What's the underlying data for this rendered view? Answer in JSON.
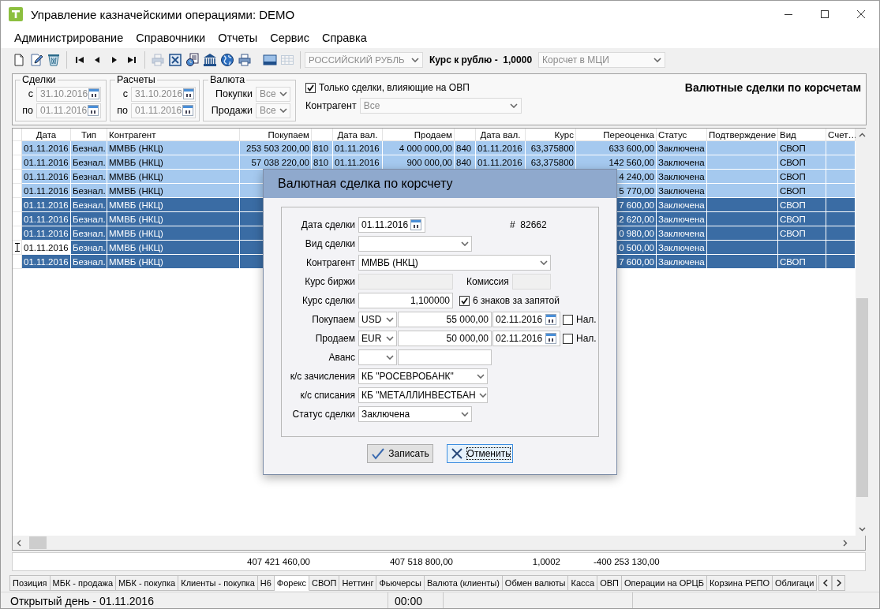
{
  "window": {
    "title": "Управление казначейскими операциями: DEMO"
  },
  "menu": [
    "Администрирование",
    "Справочники",
    "Отчеты",
    "Сервис",
    "Справка"
  ],
  "toolbar": {
    "buttons": [
      {
        "kind": "new",
        "disabled": false
      },
      {
        "kind": "edit",
        "disabled": false
      },
      {
        "kind": "delete",
        "disabled": false
      },
      {
        "kind": "first",
        "disabled": false
      },
      {
        "kind": "prev",
        "disabled": false
      },
      {
        "kind": "next",
        "disabled": false
      },
      {
        "kind": "last",
        "disabled": false
      },
      {
        "kind": "print",
        "disabled": true
      },
      {
        "kind": "excel",
        "disabled": false
      },
      {
        "kind": "report",
        "disabled": false
      },
      {
        "kind": "bank",
        "disabled": false
      },
      {
        "kind": "globe",
        "disabled": false
      },
      {
        "kind": "printer",
        "disabled": false
      },
      {
        "kind": "window",
        "disabled": false
      },
      {
        "kind": "table",
        "disabled": true
      }
    ],
    "currency": {
      "value": "РОССИЙСКИЙ РУБЛЬ",
      "disabled": true
    },
    "rate_label": "Курс к рублю -  1,0000",
    "account": {
      "value": "Корсчет в МЦИ",
      "disabled": true
    }
  },
  "filters": {
    "groups": [
      {
        "title": "Сделки",
        "from_label": "с",
        "from": "31.10.2016",
        "to_label": "по",
        "to": "01.11.2016",
        "disabled": true
      },
      {
        "title": "Расчеты",
        "from_label": "с",
        "from": "31.10.2016",
        "to_label": "по",
        "to": "01.11.2016",
        "disabled": true
      }
    ],
    "currency": {
      "title": "Валюта",
      "buy_label": "Покупки",
      "buy": "Все",
      "sell_label": "Продажи",
      "sell": "Все",
      "disabled": true
    },
    "ovp_only": {
      "label": "Только сделки, влияющие на ОВП",
      "checked": true
    },
    "counterparty": {
      "label": "Контрагент",
      "value": "Все",
      "disabled": true
    },
    "heading": "Валютные сделки по корсчетам"
  },
  "grid": {
    "columns": [
      {
        "label": "Дата"
      },
      {
        "label": "Тип"
      },
      {
        "label": "Контрагент"
      },
      {
        "label": "Покупаем"
      },
      {},
      {
        "label": "Дата вал."
      },
      {
        "label": "Продаем"
      },
      {},
      {
        "label": "Дата вал."
      },
      {
        "label": "Курс"
      },
      {
        "label": "Переоценка"
      },
      {
        "label": "Статус"
      },
      {
        "label": "Подтверждение"
      },
      {
        "label": "Вид"
      },
      {
        "label": "Счет…"
      }
    ],
    "rows": [
      {
        "selected": false,
        "current": false,
        "date": "01.11.2016",
        "type": "Безнал.",
        "counterparty": "ММВБ (НКЦ)",
        "buy": "253 503 200,00",
        "buy_cur": "810",
        "buy_date": "01.11.2016",
        "sell": "4 000 000,00",
        "sell_cur": "840",
        "sell_date": "01.11.2016",
        "rate": "63,375800",
        "reval": "633 600,00",
        "status": "Заключена",
        "kind": "СВОП"
      },
      {
        "selected": false,
        "current": false,
        "date": "01.11.2016",
        "type": "Безнал.",
        "counterparty": "ММВБ (НКЦ)",
        "buy": "57 038 220,00",
        "buy_cur": "810",
        "buy_date": "01.11.2016",
        "sell": "900 000,00",
        "sell_cur": "840",
        "sell_date": "01.11.2016",
        "rate": "63,375800",
        "reval": "142 560,00",
        "status": "Заключена",
        "kind": "СВОП"
      },
      {
        "selected": false,
        "current": false,
        "date": "01.11.2016",
        "type": "Безнал.",
        "counterparty": "ММВБ (НКЦ)",
        "reval": "4 240,00",
        "status": "Заключена",
        "kind": "СВОП"
      },
      {
        "selected": false,
        "current": false,
        "date": "01.11.2016",
        "type": "Безнал.",
        "counterparty": "ММВБ (НКЦ)",
        "reval": "5 770,00",
        "status": "Заключена",
        "kind": "СВОП"
      },
      {
        "selected": true,
        "current": false,
        "date": "01.11.2016",
        "type": "Безнал.",
        "counterparty": "ММВБ (НКЦ)",
        "reval": "7 600,00",
        "status": "Заключена",
        "kind": "СВОП"
      },
      {
        "selected": true,
        "current": false,
        "date": "01.11.2016",
        "type": "Безнал.",
        "counterparty": "ММВБ (НКЦ)",
        "reval": "2 620,00",
        "status": "Заключена",
        "kind": "СВОП"
      },
      {
        "selected": true,
        "current": false,
        "date": "01.11.2016",
        "type": "Безнал.",
        "counterparty": "ММВБ (НКЦ)",
        "reval": "0 980,00",
        "status": "Заключена",
        "kind": "СВОП"
      },
      {
        "selected": true,
        "current": true,
        "date": "01.11.2016",
        "type": "Безнал.",
        "counterparty": "ММВБ (НКЦ)",
        "reval": "0 500,00",
        "status": "Заключена"
      },
      {
        "selected": true,
        "current": false,
        "date": "01.11.2016",
        "type": "Безнал.",
        "counterparty": "ММВБ (НКЦ)",
        "reval": "7 600,00",
        "status": "Заключена",
        "kind": "СВОП"
      }
    ],
    "totals": {
      "buy": "407 421 460,00",
      "sell": "407 518 800,00",
      "rate": "1,0002",
      "reval": "-400 253 130,00"
    }
  },
  "dialog": {
    "title": "Валютная сделка по корсчету",
    "rows": [
      {
        "label": "Дата сделки",
        "controls": [
          {
            "kind": "date",
            "value": "01.11.2016"
          },
          {
            "kind": "note",
            "text": "#  82662"
          }
        ]
      },
      {
        "label": "Вид сделки",
        "controls": [
          {
            "kind": "combo"
          }
        ]
      },
      {
        "label": "Контрагент",
        "controls": [
          {
            "kind": "combo",
            "value": "ММВБ (НКЦ)"
          }
        ]
      },
      {
        "label": "Курс биржи",
        "controls": [
          {
            "kind": "readonly"
          },
          {
            "kind": "note",
            "text": "Комиссия"
          },
          {
            "kind": "readonly"
          }
        ]
      },
      {
        "label": "Курс сделки",
        "controls": [
          {
            "kind": "number",
            "value": "1,100000"
          },
          {
            "kind": "checkbox",
            "label": "6 знаков за запятой",
            "checked": true
          }
        ]
      },
      {
        "label": "Покупаем",
        "controls": [
          {
            "kind": "combo",
            "value": "USD"
          },
          {
            "kind": "number",
            "value": "55 000,00"
          },
          {
            "kind": "date",
            "value": "02.11.2016"
          },
          {
            "kind": "checkbox",
            "label": "Нал.",
            "checked": false
          }
        ]
      },
      {
        "label": "Продаем",
        "controls": [
          {
            "kind": "combo",
            "value": "EUR"
          },
          {
            "kind": "number",
            "value": "50 000,00"
          },
          {
            "kind": "date",
            "value": "02.11.2016"
          },
          {
            "kind": "checkbox",
            "label": "Нал.",
            "checked": false
          }
        ]
      },
      {
        "label": "Аванс",
        "controls": [
          {
            "kind": "combo"
          },
          {
            "kind": "number"
          }
        ]
      },
      {
        "label": "к/с зачисления",
        "controls": [
          {
            "kind": "combo",
            "value": "КБ \"РОСЕВРОБАНК\""
          }
        ]
      },
      {
        "label": "к/с списания",
        "controls": [
          {
            "kind": "combo",
            "value": "КБ \"МЕТАЛЛИНВЕСТБАН"
          }
        ]
      },
      {
        "label": "Статус сделки",
        "controls": [
          {
            "kind": "combo",
            "value": "Заключена"
          }
        ]
      }
    ],
    "buttons": [
      {
        "kind": "save",
        "label": "Записать",
        "focused": false
      },
      {
        "kind": "cancel",
        "label": "Отменить",
        "focused": true
      }
    ]
  },
  "tabs": [
    {
      "label": "Позиция",
      "selected": false
    },
    {
      "label": "МБК - продажа",
      "selected": false
    },
    {
      "label": "МБК - покупка",
      "selected": false
    },
    {
      "label": "Клиенты - покупка",
      "selected": false
    },
    {
      "label": "Н6",
      "selected": false
    },
    {
      "label": "Форекс",
      "selected": true
    },
    {
      "label": "СВОП",
      "selected": false
    },
    {
      "label": "Неттинг",
      "selected": false
    },
    {
      "label": "Фьючерсы",
      "selected": false
    },
    {
      "label": "Валюта (клиенты)",
      "selected": false
    },
    {
      "label": "Обмен валюты",
      "selected": false
    },
    {
      "label": "Касса",
      "selected": false
    },
    {
      "label": "ОВП",
      "selected": false
    },
    {
      "label": "Операции на ОРЦБ",
      "selected": false
    },
    {
      "label": "Корзина РЕПО",
      "selected": false
    },
    {
      "label": "Облигаци",
      "selected": false
    }
  ],
  "status_bar": {
    "text": "Открытый день - 01.11.2016",
    "time": "00:00"
  }
}
